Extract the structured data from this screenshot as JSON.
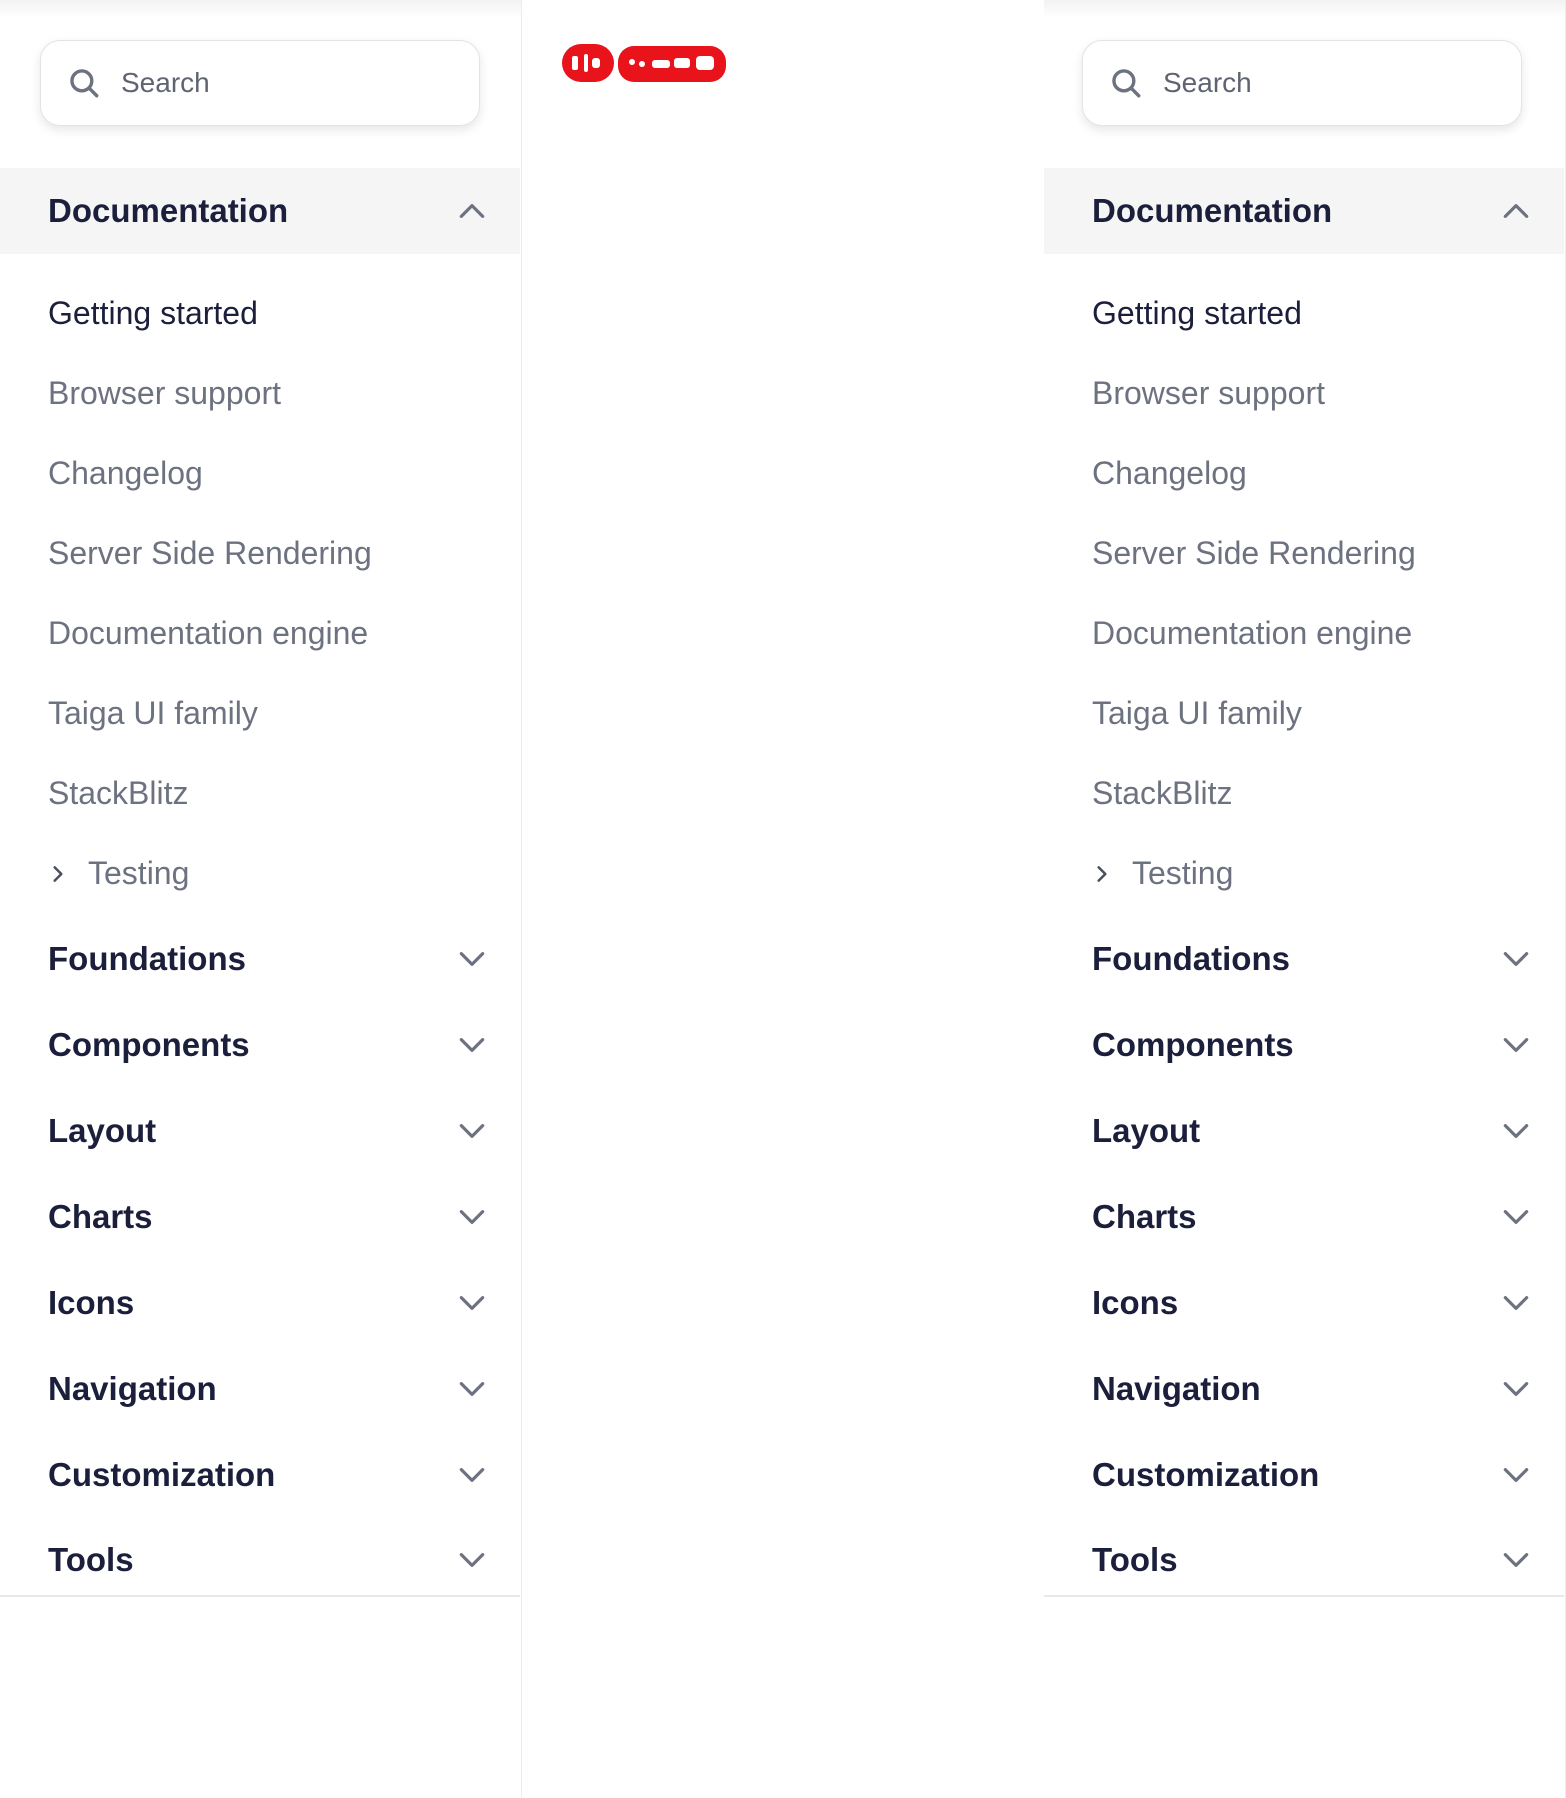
{
  "search": {
    "placeholder": "Search"
  },
  "nav": {
    "active_section": "Documentation",
    "documentation_items": [
      "Getting started",
      "Browser support",
      "Changelog",
      "Server Side Rendering",
      "Documentation engine",
      "Taiga UI family",
      "StackBlitz"
    ],
    "subgroup": "Testing",
    "sections": [
      "Foundations",
      "Components",
      "Layout",
      "Charts",
      "Icons",
      "Navigation",
      "Customization",
      "Tools"
    ]
  },
  "icons": {
    "search": "search-icon",
    "expanded": "chevron-up-icon",
    "collapsed": "chevron-down-icon",
    "subgroup": "chevron-right-icon"
  },
  "colors": {
    "text_strong": "#1b1f3b",
    "text_muted": "#6d7280",
    "active_bg": "#f5f5f6",
    "badge": "#e8131b"
  }
}
